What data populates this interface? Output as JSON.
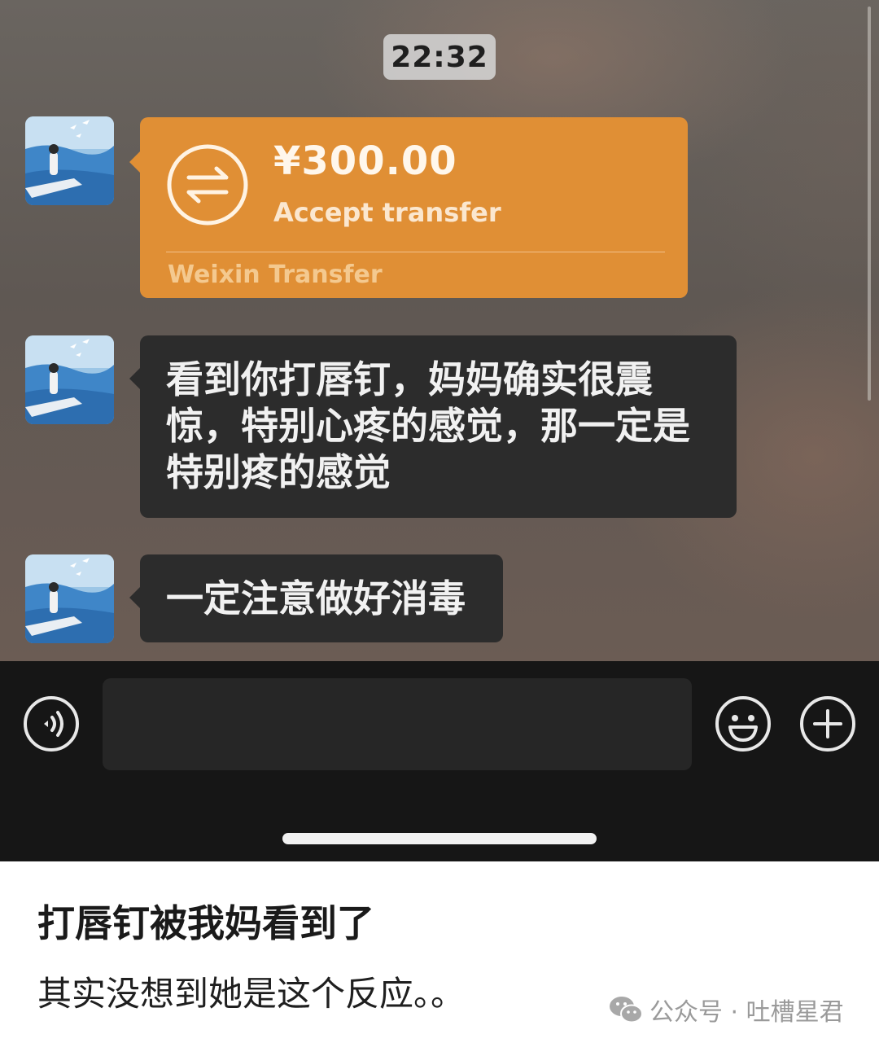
{
  "chat": {
    "timestamp": "22:32",
    "messages": [
      {
        "type": "transfer",
        "amount": "¥300.00",
        "status": "Accept transfer",
        "footer": "Weixin Transfer"
      },
      {
        "type": "text",
        "text": "看到你打唇钉，妈妈确实很震惊，特别心疼的感觉，那一定是特别疼的感觉"
      },
      {
        "type": "text",
        "text": "一定注意做好消毒"
      }
    ]
  },
  "input_bar": {
    "value": "",
    "icons": [
      "voice-icon",
      "emoji-icon",
      "plus-icon"
    ]
  },
  "caption": {
    "title": "打唇钉被我妈看到了",
    "text": "其实没想到她是这个反应。。"
  },
  "watermark": {
    "text": "公众号 · 吐槽星君",
    "icon": "wechat-icon"
  },
  "colors": {
    "transfer_bubble": "#e08f35",
    "text_bubble": "#2c2c2c",
    "input_bar": "#161616"
  }
}
